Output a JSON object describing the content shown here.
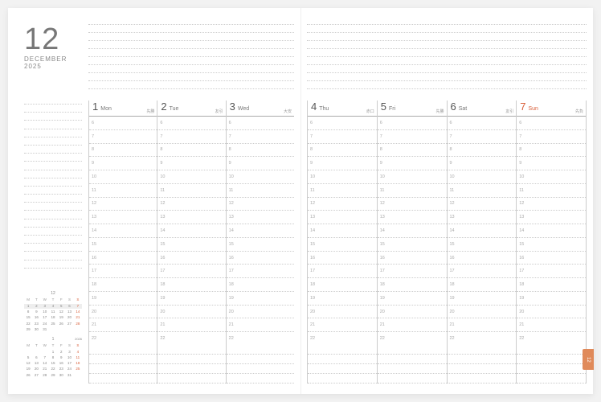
{
  "header": {
    "month_num": "12",
    "month_name": "DECEMBER",
    "year": "2025"
  },
  "days": [
    {
      "num": "1",
      "abbr": "Mon",
      "jp": "先勝"
    },
    {
      "num": "2",
      "abbr": "Tue",
      "jp": "友引"
    },
    {
      "num": "3",
      "abbr": "Wed",
      "jp": "大安"
    },
    {
      "num": "4",
      "abbr": "Thu",
      "jp": "赤口"
    },
    {
      "num": "5",
      "abbr": "Fri",
      "jp": "先勝"
    },
    {
      "num": "6",
      "abbr": "Sat",
      "jp": "友引"
    },
    {
      "num": "7",
      "abbr": "Sun",
      "jp": "先負"
    }
  ],
  "hours": [
    "6",
    "7",
    "8",
    "9",
    "10",
    "11",
    "12",
    "13",
    "14",
    "15",
    "16",
    "17",
    "18",
    "19",
    "20",
    "21",
    "22"
  ],
  "mini_dow": [
    "M",
    "T",
    "W",
    "T",
    "F",
    "S",
    "S"
  ],
  "mini_dec": {
    "title": "12",
    "cells": [
      "1",
      "2",
      "3",
      "4",
      "5",
      "6",
      "7",
      "8",
      "9",
      "10",
      "11",
      "12",
      "13",
      "14",
      "15",
      "16",
      "17",
      "18",
      "19",
      "20",
      "21",
      "22",
      "23",
      "24",
      "25",
      "26",
      "27",
      "28",
      "29",
      "30",
      "31",
      "",
      "",
      "",
      ""
    ],
    "highlight_row": 0,
    "sundays": [
      6,
      13,
      20,
      27
    ]
  },
  "mini_jan": {
    "title": "1",
    "year": "2026",
    "cells": [
      "",
      "",
      "",
      "1",
      "2",
      "3",
      "4",
      "5",
      "6",
      "7",
      "8",
      "9",
      "10",
      "11",
      "12",
      "13",
      "14",
      "15",
      "16",
      "17",
      "18",
      "19",
      "20",
      "21",
      "22",
      "23",
      "24",
      "25",
      "26",
      "27",
      "28",
      "29",
      "30",
      "31",
      ""
    ],
    "sundays": [
      6,
      13,
      20,
      27,
      34
    ]
  },
  "tab": {
    "label": "12"
  },
  "colors": {
    "accent": "#d9603b",
    "tab": "#e08a5a",
    "text": "#555",
    "muted": "#aaa"
  }
}
